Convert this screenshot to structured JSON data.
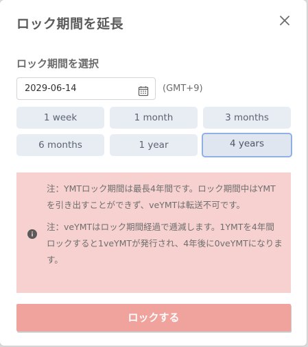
{
  "modal": {
    "title": "ロック期間を延長",
    "close_icon": "close-icon"
  },
  "lock_period": {
    "label": "ロック期間を選択",
    "date_value": "2029-06-14",
    "calendar_icon": "calendar-icon",
    "timezone": "(GMT+9)",
    "options": [
      {
        "label": "1 week",
        "selected": false
      },
      {
        "label": "1 month",
        "selected": false
      },
      {
        "label": "3 months",
        "selected": false
      },
      {
        "label": "6 months",
        "selected": false
      },
      {
        "label": "1 year",
        "selected": false
      },
      {
        "label": "4 years",
        "selected": true
      }
    ]
  },
  "notice": {
    "icon": "info-icon",
    "paragraph1": "注：YMTロック期間は最長4年間です。ロック期間中はYMTを引き出すことができず、veYMTは転送不可です。",
    "paragraph2": "注：veYMTはロック期間経過で逓減します。1YMTを4年間ロックすると1veYMTが発行され、4年後に0veYMTになります。"
  },
  "actions": {
    "lock_label": "ロックする"
  },
  "colors": {
    "accent_selected_border": "#8fb0e2",
    "notice_bg": "#f6d1cf",
    "button_bg": "#f0a39c"
  }
}
